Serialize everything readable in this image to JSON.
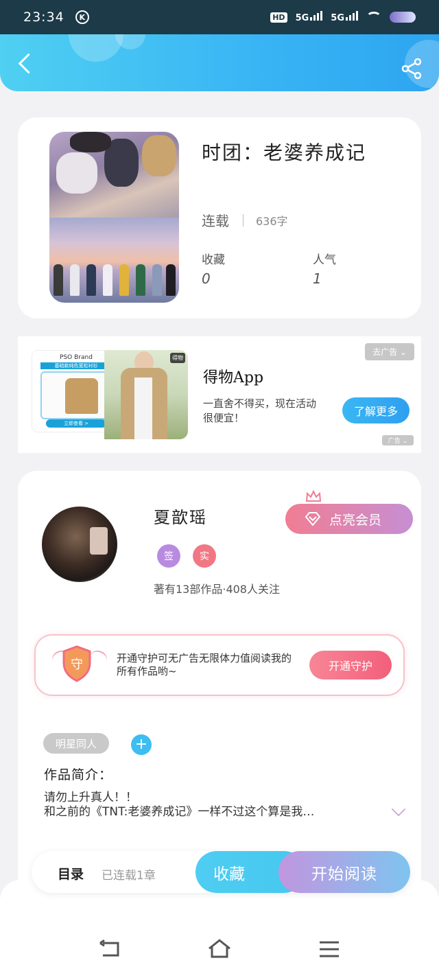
{
  "status_bar": {
    "time": "23:34",
    "k_icon": "K",
    "hd": "HD",
    "net1": "5G",
    "net2": "5G"
  },
  "header": {
    "back_icon": "chevron-left-icon",
    "share_icon": "share-icon"
  },
  "book": {
    "title": "时团：老婆养成记",
    "status": "连载",
    "word_count": "636字",
    "favorites_label": "收藏",
    "favorites_value": "0",
    "popularity_label": "人气",
    "popularity_value": "1"
  },
  "ad": {
    "close_label": "去广告 ⌄",
    "brand": "PSO Brand",
    "strip_text": "基础款纯色宽松衬衫",
    "cta_small": "立即查看 >",
    "badge": "得物",
    "title": "得物App",
    "desc": "一直舍不得买，现在活动很便宜！",
    "button": "了解更多",
    "mark": "广告 ⌄"
  },
  "author": {
    "name": "夏歆瑶",
    "vip_button": "点亮会员",
    "tag1": "签",
    "tag2": "实",
    "meta": "著有13部作品·408人关注",
    "guard_shield": "守",
    "guard_text": "开通守护可无广告无限体力值阅读我的所有作品哟~",
    "guard_button": "开通守护"
  },
  "work": {
    "genre_tag": "明星同人",
    "add_tag": "+",
    "intro_title": "作品简介：",
    "intro_line1": "请勿上升真人！！",
    "intro_line2": "和之前的《TNT:老婆养成记》一样不过这个算是我…"
  },
  "action_bar": {
    "toc_label": "目录",
    "toc_status": "已连载1章",
    "favorite_button": "收藏",
    "read_button": "开始阅读"
  },
  "colors": {
    "accent_blue": "#38b4f4",
    "vip_pink": "#f17d92",
    "vip_purple": "#c68fd3",
    "tag_sign": "#b98be0",
    "tag_real": "#f07884"
  }
}
